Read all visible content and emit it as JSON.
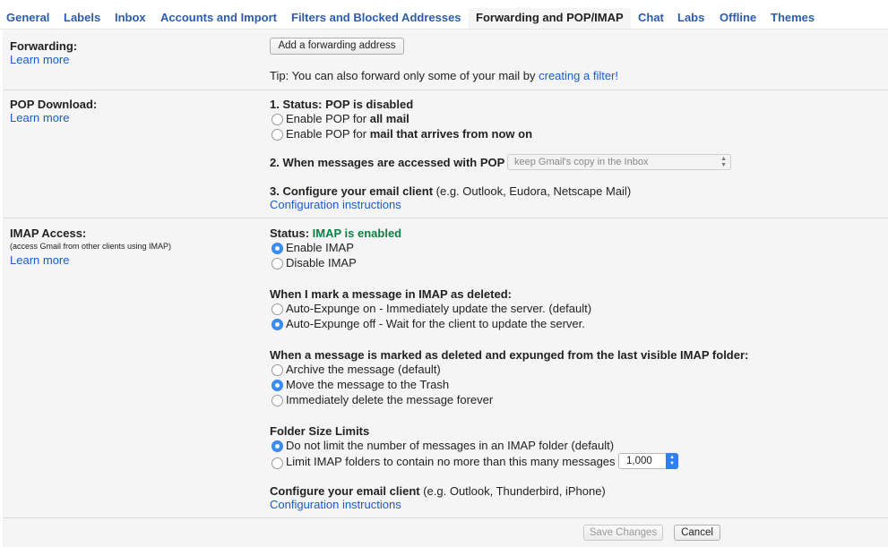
{
  "tabs": [
    {
      "label": "General"
    },
    {
      "label": "Labels"
    },
    {
      "label": "Inbox"
    },
    {
      "label": "Accounts and Import"
    },
    {
      "label": "Filters and Blocked Addresses"
    },
    {
      "label": "Forwarding and POP/IMAP"
    },
    {
      "label": "Chat"
    },
    {
      "label": "Labs"
    },
    {
      "label": "Offline"
    },
    {
      "label": "Themes"
    }
  ],
  "active_tab": "Forwarding and POP/IMAP",
  "forwarding": {
    "title": "Forwarding:",
    "learn_more": "Learn more",
    "add_button": "Add a forwarding address",
    "tip_prefix": "Tip: You can also forward only some of your mail by ",
    "tip_link": "creating a filter!"
  },
  "pop": {
    "title": "POP Download:",
    "learn_more": "Learn more",
    "status_label": "1. Status: ",
    "status_value": "POP is disabled",
    "opt_all_prefix": "Enable POP for ",
    "opt_all_bold": "all mail",
    "opt_now_prefix": "Enable POP for ",
    "opt_now_bold": "mail that arrives from now on",
    "accessed_label": "2. When messages are accessed with POP",
    "accessed_select": "keep Gmail's copy in the Inbox",
    "configure_label": "3. Configure your email client",
    "configure_hint": " (e.g. Outlook, Eudora, Netscape Mail)",
    "config_link": "Configuration instructions"
  },
  "imap": {
    "title": "IMAP Access:",
    "subtitle": "(access Gmail from other clients using IMAP)",
    "learn_more": "Learn more",
    "status_label": "Status: ",
    "status_value": "IMAP is enabled",
    "enable": "Enable IMAP",
    "disable": "Disable IMAP",
    "deleted_heading": "When I mark a message in IMAP as deleted:",
    "expunge_on": "Auto-Expunge on - Immediately update the server. (default)",
    "expunge_off": "Auto-Expunge off - Wait for the client to update the server.",
    "expunged_heading": "When a message is marked as deleted and expunged from the last visible IMAP folder:",
    "archive": "Archive the message (default)",
    "trash": "Move the message to the Trash",
    "delete_forever": "Immediately delete the message forever",
    "folder_heading": "Folder Size Limits",
    "no_limit": "Do not limit the number of messages in an IMAP folder (default)",
    "limit": "Limit IMAP folders to contain no more than this many messages",
    "limit_value": "1,000",
    "configure_label": "Configure your email client",
    "configure_hint": " (e.g. Outlook, Thunderbird, iPhone)",
    "config_link": "Configuration instructions"
  },
  "footer": {
    "save": "Save Changes",
    "cancel": "Cancel"
  }
}
